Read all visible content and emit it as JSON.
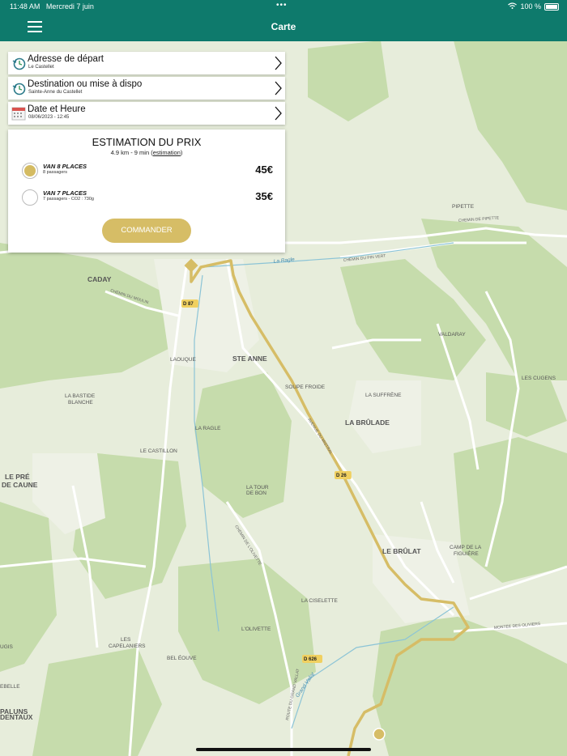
{
  "status": {
    "time": "11:48 AM",
    "date": "Mercredi 7 juin",
    "dots": "•••",
    "battery": "100 %"
  },
  "nav": {
    "title": "Carte"
  },
  "rows": [
    {
      "title": "Adresse de départ",
      "sub": "Le Castellet"
    },
    {
      "title": "Destination ou mise à dispo",
      "sub": "Sainte-Anne du Castellet"
    },
    {
      "title": "Date et Heure",
      "sub": "08/06/2023 - 12:45"
    }
  ],
  "estimate": {
    "title": "ESTIMATION DU PRIX",
    "meta_prefix": "4.9 km - 9 min (",
    "meta_link": "estimation",
    "meta_suffix": ")",
    "options": [
      {
        "name": "VAN 8 PLACES",
        "detail": "8 passagers",
        "price": "45€",
        "selected": true
      },
      {
        "name": "VAN 7 PLACES",
        "detail": "7 passagers - CO2 : 730g",
        "price": "35€",
        "selected": false
      }
    ],
    "order_label": "COMMANDER"
  },
  "map": {
    "labels": [
      {
        "text": "CADAY",
        "kind": "place"
      },
      {
        "text": "STE ANNE",
        "kind": "place"
      },
      {
        "text": "LAOUQUE",
        "kind": "small"
      },
      {
        "text": "LA BASTIDE",
        "kind": "small"
      },
      {
        "text": "BLANCHE",
        "kind": "small"
      },
      {
        "text": "LA RAGLE",
        "kind": "small"
      },
      {
        "text": "LE CASTILLON",
        "kind": "small"
      },
      {
        "text": "LE PRÉ",
        "kind": "place"
      },
      {
        "text": "DE CAUNE",
        "kind": "place"
      },
      {
        "text": "LA TOUR",
        "kind": "small"
      },
      {
        "text": "DE BON",
        "kind": "small"
      },
      {
        "text": "SOUPE FROIDE",
        "kind": "small"
      },
      {
        "text": "LA SUFFRÈNE",
        "kind": "small"
      },
      {
        "text": "LA BRÛLADE",
        "kind": "place"
      },
      {
        "text": "LE BRÛLAT",
        "kind": "place"
      },
      {
        "text": "CAMP DE LA",
        "kind": "small"
      },
      {
        "text": "FIGUIÈRE",
        "kind": "small"
      },
      {
        "text": "LA CISELETTE",
        "kind": "small"
      },
      {
        "text": "L'OLIVETTE",
        "kind": "small"
      },
      {
        "text": "LES",
        "kind": "small"
      },
      {
        "text": "CAPELANIERS",
        "kind": "small"
      },
      {
        "text": "BEL ÉOUVE",
        "kind": "small"
      },
      {
        "text": "PALUNS",
        "kind": "place"
      },
      {
        "text": "DENTAUX",
        "kind": "place"
      },
      {
        "text": "PIPETTE",
        "kind": "small"
      },
      {
        "text": "VALDARAY",
        "kind": "small"
      },
      {
        "text": "LES CUGENS",
        "kind": "small"
      },
      {
        "text": "CHEMIN DE PIPETTE",
        "kind": "road"
      },
      {
        "text": "CHEMIN DU PIN VERT",
        "kind": "road"
      },
      {
        "text": "CHEMIN DU MOULIN",
        "kind": "road"
      },
      {
        "text": "AVENUE DU MISTRAL",
        "kind": "road"
      },
      {
        "text": "MONTÉE DES OLIVIERS",
        "kind": "road"
      },
      {
        "text": "CHEMIN DE L'OLIVETTE",
        "kind": "road"
      },
      {
        "text": "ROUTE DU GRAND VALLAT",
        "kind": "road"
      },
      {
        "text": "La Ragle",
        "kind": "water"
      },
      {
        "text": "Grand Vallat",
        "kind": "water"
      },
      {
        "text": "D 87",
        "kind": "shield"
      },
      {
        "text": "D 26",
        "kind": "shield"
      },
      {
        "text": "D 626",
        "kind": "shield"
      },
      {
        "text": "UGIS",
        "kind": "small"
      },
      {
        "text": "EBELLE",
        "kind": "small"
      }
    ]
  }
}
